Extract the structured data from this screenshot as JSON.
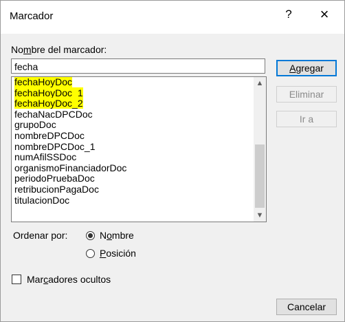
{
  "window": {
    "title": "Marcador",
    "help_icon": "?",
    "close_icon": "×"
  },
  "name_field": {
    "label_prefix": "No",
    "label_underlined": "m",
    "label_suffix": "bre del marcador:",
    "value": "fecha"
  },
  "list": {
    "items": [
      "fechaHoyDoc",
      "fechaHoyDoc_1",
      "fechaHoyDoc_2",
      "fechaNacDPCDoc",
      "grupoDoc",
      "nombreDPCDoc",
      "nombreDPCDoc_1",
      "numAfilSSDoc",
      "organismoFinanciadorDoc",
      "periodoPruebaDoc",
      "retribucionPagaDoc",
      "titulacionDoc"
    ],
    "highlight_color": "#ffff00"
  },
  "buttons": {
    "add_underlined": "A",
    "add_rest": "gregar",
    "delete": "Eliminar",
    "goto": "Ir a",
    "cancel": "Cancelar"
  },
  "sort": {
    "label": "Ordenar por:",
    "name_prefix": "N",
    "name_underlined": "o",
    "name_suffix": "mbre",
    "pos_underlined": "P",
    "pos_suffix": "osición",
    "selected": "Nombre"
  },
  "hidden": {
    "prefix": "Mar",
    "underlined": "c",
    "suffix": "adores ocultos",
    "checked": false
  },
  "colors": {
    "accent": "#0078d7"
  }
}
